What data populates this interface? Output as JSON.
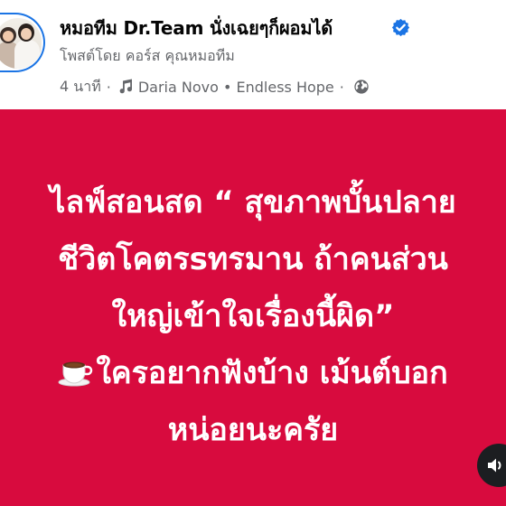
{
  "header": {
    "page_name": "หมอทีม Dr.Team นั่งเฉยๆก็ผอมได้",
    "posted_by": "โพสต์โดย คอร์ส คุณหมอทีม",
    "time": "4 นาที",
    "separator": "·",
    "music": "Daria Novo • Endless Hope",
    "separator2": "·"
  },
  "icons": {
    "verified": "verified-badge-icon",
    "music": "music-note-icon",
    "audience": "globe-icon",
    "coffee": "coffee-cup-icon",
    "sound": "speaker-icon"
  },
  "post": {
    "lines": [
      "ไลฟ์สอนสด “ สุขภาพบั้นปลาย",
      "ชีวิตโคตรsทรมาน ถ้าคนส่วน",
      "ใหญ่เข้าใจเรื่องนี้ผิด”",
      "ใครอยากฟังบ้าง เม้นต์บอก",
      "หน่อยนะครัย"
    ]
  },
  "colors": {
    "post_background": "#d80b3e",
    "verified_blue": "#1b74e4",
    "secondary_text": "#65676b"
  }
}
